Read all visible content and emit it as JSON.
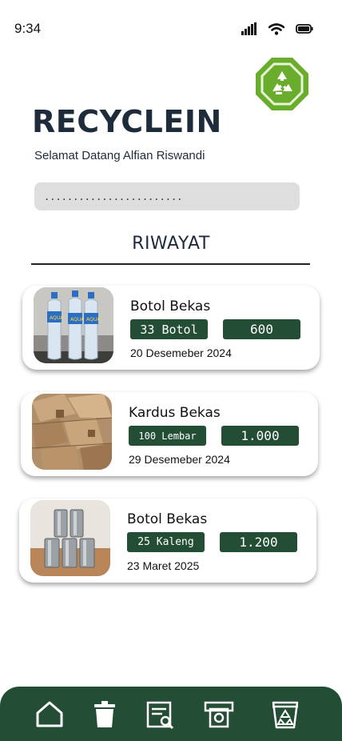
{
  "status_bar": {
    "time": "9:34",
    "icons": [
      "signal-icon",
      "wifi-icon",
      "battery-icon"
    ]
  },
  "app": {
    "title": "RECYCLEIN",
    "welcome": "Selamat Datang Alfian Riswandi",
    "logo": "recycle-icon"
  },
  "search": {
    "placeholder": "........................"
  },
  "history": {
    "title": "RIWAYAT",
    "items": [
      {
        "name": "Botol Bekas",
        "quantity": "33 Botol",
        "value": "600",
        "date": "20 Desemeber 2024",
        "image": "plastic-bottles"
      },
      {
        "name": "Kardus Bekas",
        "quantity": "100 Lembar",
        "value": "1.000",
        "date": "29 Desemeber 2024",
        "image": "cardboard"
      },
      {
        "name": "Botol Bekas",
        "quantity": "25 Kaleng",
        "value": "1.200",
        "date": "23 Maret 2025",
        "image": "tin-cans"
      }
    ]
  },
  "nav": {
    "items": [
      "home-icon",
      "trash-icon",
      "report-search-icon",
      "money-icon",
      "recycle-bin-icon"
    ]
  },
  "colors": {
    "primary": "#234d34",
    "accent": "#6aad2c",
    "title": "#1d2b3a",
    "search_bg": "#dedede"
  }
}
